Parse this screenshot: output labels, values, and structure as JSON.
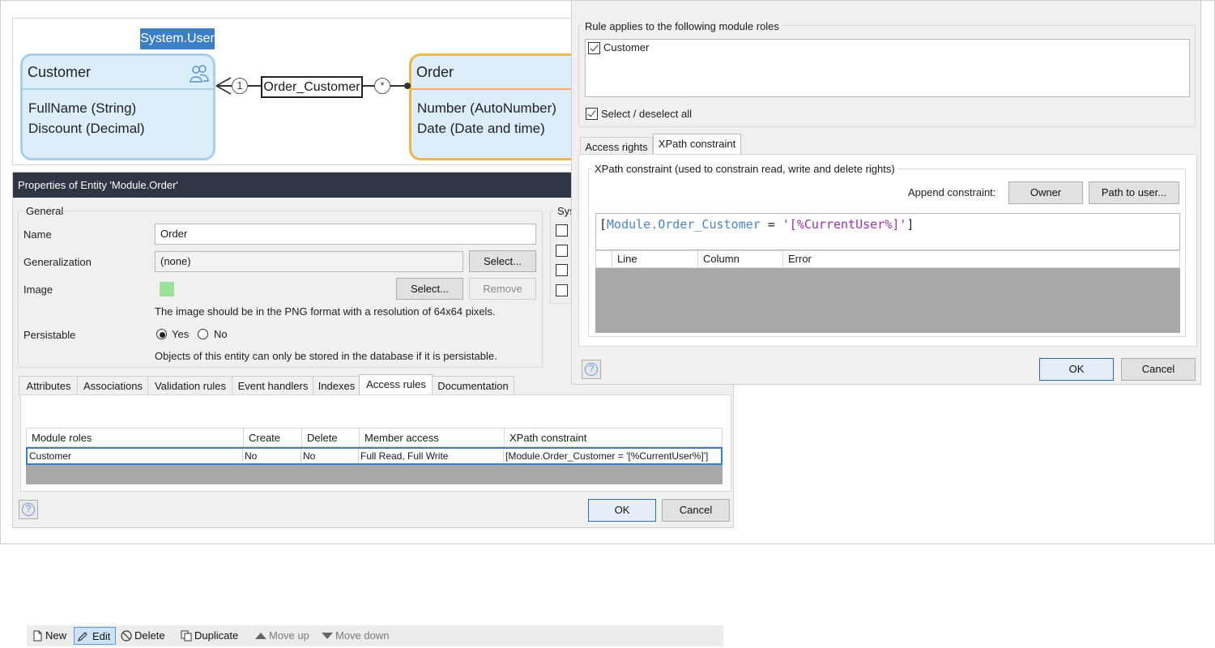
{
  "domain_model": {
    "system_user_label": "System.User",
    "customer_entity": {
      "title": "Customer",
      "attributes": [
        "FullName (String)",
        "Discount (Decimal)"
      ]
    },
    "order_entity": {
      "title": "Order",
      "attributes": [
        "Number (AutoNumber)",
        "Date (Date and time)"
      ]
    },
    "association": {
      "name": "Order_Customer",
      "left_multiplicity": "1",
      "right_multiplicity": "*"
    }
  },
  "properties": {
    "title": "Properties of Entity 'Module.Order'",
    "general_legend": "General",
    "system_legend": "Sys",
    "name_label": "Name",
    "name_value": "Order",
    "generalization_label": "Generalization",
    "generalization_value": "(none)",
    "generalization_select": "Select...",
    "image_label": "Image",
    "image_select": "Select...",
    "image_remove": "Remove",
    "image_hint": "The image should be in the PNG format with a resolution of 64x64 pixels.",
    "persistable_label": "Persistable",
    "yes_label": "Yes",
    "no_label": "No",
    "persistable_hint": "Objects of this entity can only be stored in the database if it is persistable.",
    "tabs": [
      "Attributes",
      "Associations",
      "Validation rules",
      "Event handlers",
      "Indexes",
      "Access rules",
      "Documentation"
    ],
    "toolbar": {
      "new": "New",
      "edit": "Edit",
      "delete": "Delete",
      "duplicate": "Duplicate",
      "move_up": "Move up",
      "move_down": "Move down"
    },
    "grid": {
      "headers": [
        "Module roles",
        "Create",
        "Delete",
        "Member access",
        "XPath constraint"
      ],
      "row": [
        "Customer",
        "No",
        "No",
        "Full Read, Full Write",
        "[Module.Order_Customer = '[%CurrentUser%]']"
      ]
    },
    "ok": "OK",
    "cancel": "Cancel",
    "help": "?"
  },
  "rule_dialog": {
    "roles_legend": "Rule applies to the following module roles",
    "role_customer": "Customer",
    "select_all": "Select / deselect all",
    "tabs": [
      "Access rights",
      "XPath constraint"
    ],
    "xpath_legend": "XPath constraint (used to constrain read, write and delete rights)",
    "append_label": "Append constraint:",
    "owner_button": "Owner",
    "path_button": "Path to user...",
    "xpath_open": "[",
    "xpath_path": "Module.Order_Customer",
    "xpath_op": " = ",
    "xpath_value": "'[%CurrentUser%]'",
    "xpath_close": "]",
    "error_headers": [
      "Line",
      "Column",
      "Error"
    ],
    "ok": "OK",
    "cancel": "Cancel",
    "help": "?"
  },
  "colors": {
    "accent": "#3d7fc6",
    "entity_fill": "#dceefa",
    "customer_border": "#a8d0ee",
    "order_border": "#f0b44a",
    "title_bar": "#2f3542",
    "xpath_path": "#4a86c5",
    "xpath_value": "#9b2fae"
  }
}
